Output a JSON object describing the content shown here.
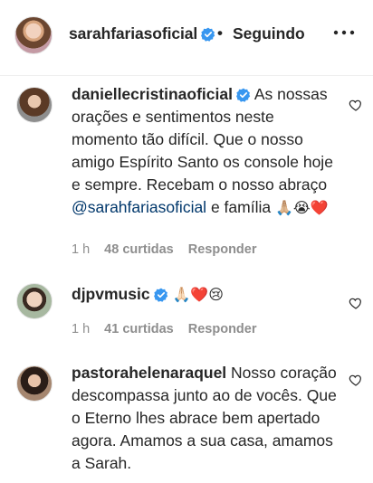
{
  "header": {
    "username": "sarahfariasoficial",
    "separator": "•",
    "follow_status": "Seguindo",
    "more_icon": "more-options-icon"
  },
  "colors": {
    "verified": "#3897f0",
    "mention": "#00376b",
    "meta": "#8e8e8e",
    "heart": "#ed4956"
  },
  "comments": [
    {
      "username": "daniellecristinaoficial",
      "text_before": " As nossas orações e sentimentos neste momento tão difícil. Que o nosso amigo Espírito Santo os console hoje e sempre. Recebam o nosso abraço ",
      "mention": "@sarahfariasoficial",
      "text_after": " e família ",
      "emojis": "🙏🏼😭❤️",
      "time": "1 h",
      "likes": "48 curtidas",
      "reply": "Responder"
    },
    {
      "username": "djpvmusic",
      "text_before": " ",
      "emojis": "🙏🏻❤️😢",
      "time": "1 h",
      "likes": "41 curtidas",
      "reply": "Responder"
    },
    {
      "username": "pastorahelenaraquel",
      "text_before": " Nosso coração descompassa junto ao de vocês. Que o Eterno lhes abrace bem apertado agora. Amamos a sua casa, amamos a Sarah."
    }
  ]
}
